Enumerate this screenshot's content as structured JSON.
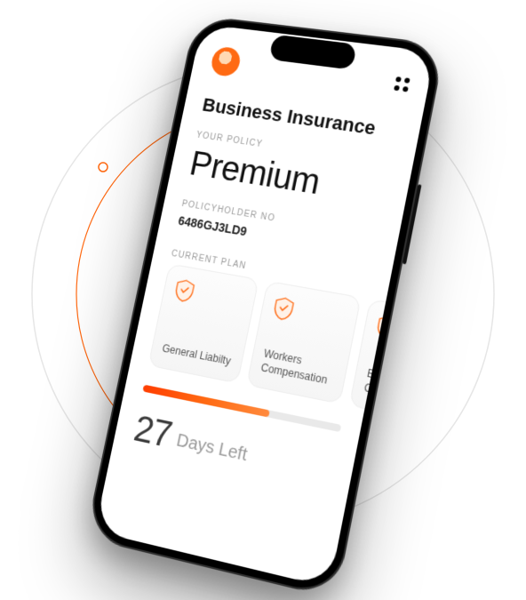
{
  "header": {
    "title": "Business Insurance"
  },
  "policy": {
    "section_label": "YOUR POLICY",
    "plan_name": "Premium",
    "holder_label": "POLICYHOLDER NO",
    "holder_no": "6486GJ3LD9"
  },
  "current_plan": {
    "section_label": "CURRENT PLAN",
    "cards": [
      {
        "label": "General Liabilty"
      },
      {
        "label": "Workers Compensation"
      },
      {
        "label": "Business Owner"
      }
    ]
  },
  "countdown": {
    "days": "27",
    "label": "Days Left",
    "progress_percent": 65
  },
  "colors": {
    "accent": "#ff6a13"
  }
}
